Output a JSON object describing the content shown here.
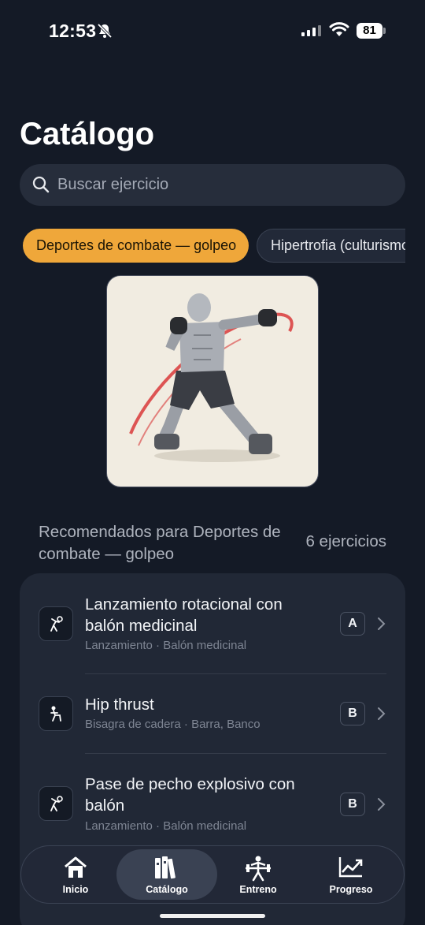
{
  "status": {
    "time": "12:53",
    "battery": "81"
  },
  "page": {
    "title": "Catálogo"
  },
  "search": {
    "placeholder": "Buscar ejercicio"
  },
  "categories": [
    {
      "label": "Deportes de combate — golpeo",
      "active": true
    },
    {
      "label": "Hipertrofia (culturismo)",
      "active": false
    }
  ],
  "section": {
    "title": "Recomendados para Deportes de combate — golpeo",
    "count": "6 ejercicios"
  },
  "exercises": [
    {
      "title": "Lanzamiento rotacional con balón medicinal",
      "subtitle": "Lanzamiento · Balón medicinal",
      "badge": "A",
      "icon": "throw-icon"
    },
    {
      "title": "Hip thrust",
      "subtitle": "Bisagra de cadera · Barra, Banco",
      "badge": "B",
      "icon": "hip-hinge-icon"
    },
    {
      "title": "Pase de pecho explosivo con balón",
      "subtitle": "Lanzamiento · Balón medicinal",
      "badge": "B",
      "icon": "throw-icon"
    }
  ],
  "tabs": [
    {
      "label": "Inicio",
      "icon": "home-icon"
    },
    {
      "label": "Catálogo",
      "icon": "catalog-icon",
      "active": true
    },
    {
      "label": "Entreno",
      "icon": "workout-icon"
    },
    {
      "label": "Progreso",
      "icon": "progress-icon"
    }
  ],
  "colors": {
    "accent": "#efa73a",
    "background": "#141a26",
    "card": "#212836"
  }
}
